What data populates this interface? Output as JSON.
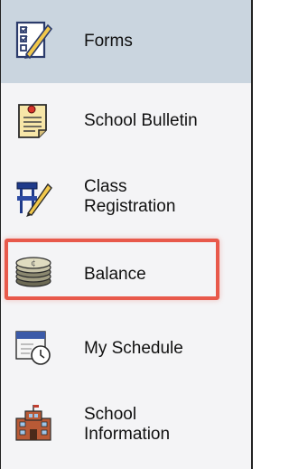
{
  "nav": {
    "items": [
      {
        "id": "forms",
        "label": "Forms",
        "icon": "forms-icon",
        "active": true
      },
      {
        "id": "bulletin",
        "label": "School Bulletin",
        "icon": "bulletin-icon",
        "active": false
      },
      {
        "id": "registration",
        "label_line1": "Class",
        "label_line2": "Registration",
        "icon": "class-registration-icon",
        "active": false
      },
      {
        "id": "balance",
        "label": "Balance",
        "icon": "coins-icon",
        "active": false,
        "highlighted": true
      },
      {
        "id": "schedule",
        "label": "My Schedule",
        "icon": "schedule-icon",
        "active": false
      },
      {
        "id": "info",
        "label_line1": "School",
        "label_line2": "Information",
        "icon": "school-building-icon",
        "active": false
      }
    ]
  },
  "colors": {
    "active_background": "#cad5df",
    "highlight_border": "#e8594b"
  }
}
